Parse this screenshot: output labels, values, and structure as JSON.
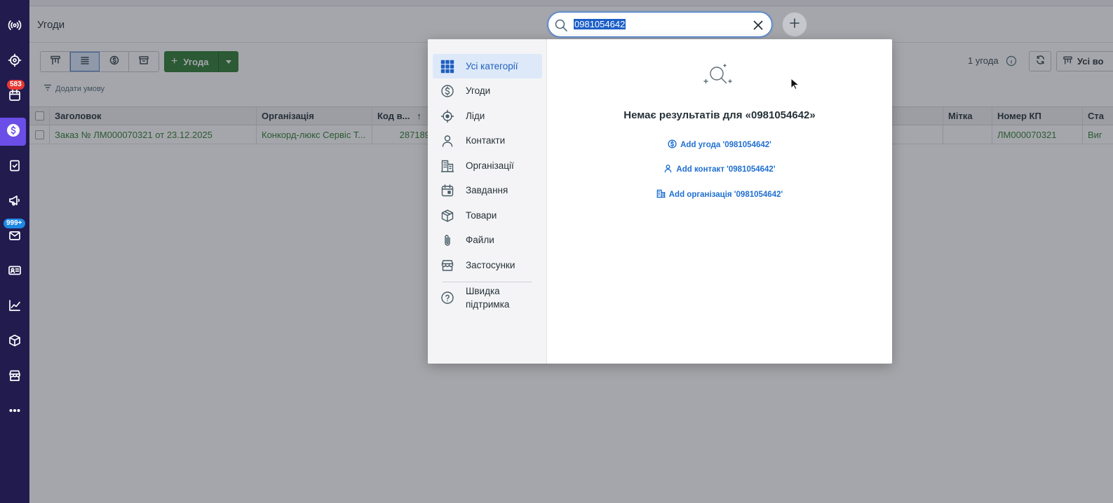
{
  "sidebar": {
    "badge_tasks": "583",
    "badge_mail": "999+",
    "items": [
      {
        "name": "radio-icon"
      },
      {
        "name": "target-icon"
      },
      {
        "name": "calendar-icon"
      },
      {
        "name": "dollar-icon"
      },
      {
        "name": "clipboard-icon"
      },
      {
        "name": "megaphone-icon"
      },
      {
        "name": "mail-icon"
      },
      {
        "name": "id-card-icon"
      },
      {
        "name": "chart-icon"
      },
      {
        "name": "box-icon"
      },
      {
        "name": "store-icon"
      },
      {
        "name": "more-icon"
      }
    ]
  },
  "header": {
    "title": "Угоди"
  },
  "toolbar": {
    "add_label": "Угода",
    "add_plus": "+",
    "filter_label": "Додати умову",
    "count_text": "1 угода",
    "pipeline_label": "Усі во"
  },
  "table": {
    "columns": {
      "title": "Заголовок",
      "organization": "Організація",
      "code": "Код в...",
      "code_sort": "↑",
      "label": "Мітка",
      "quote_number": "Номер КП",
      "stage": "Ста"
    },
    "rows": [
      {
        "title": "Заказ № ЛМ000070321 от 23.12.2025",
        "organization": "Конкорд-люкс Сервіс Т...",
        "code": "287189",
        "label": "",
        "quote_number": "ЛМ000070321",
        "stage": "Виг"
      }
    ]
  },
  "search": {
    "value": "0981054642"
  },
  "dialog": {
    "categories": [
      {
        "label": "Усі категорії",
        "selected": true
      },
      {
        "label": "Угоди"
      },
      {
        "label": "Ліди"
      },
      {
        "label": "Контакти"
      },
      {
        "label": "Організації"
      },
      {
        "label": "Завдання"
      },
      {
        "label": "Товари"
      },
      {
        "label": "Файли"
      },
      {
        "label": "Застосунки"
      }
    ],
    "help_label": "Швидка підтримка",
    "no_results": "Немає результатів для «0981054642»",
    "add_links": [
      "Add угода '0981054642'",
      "Add контакт '0981054642'",
      "Add організація '0981054642'"
    ]
  },
  "colors": {
    "sidebar": "#211b4e",
    "sidebar_active": "#6a4ee7",
    "accent_green": "#2e7d32",
    "link_blue": "#1f6fd1",
    "selected_category_bg": "#dde9f9"
  }
}
